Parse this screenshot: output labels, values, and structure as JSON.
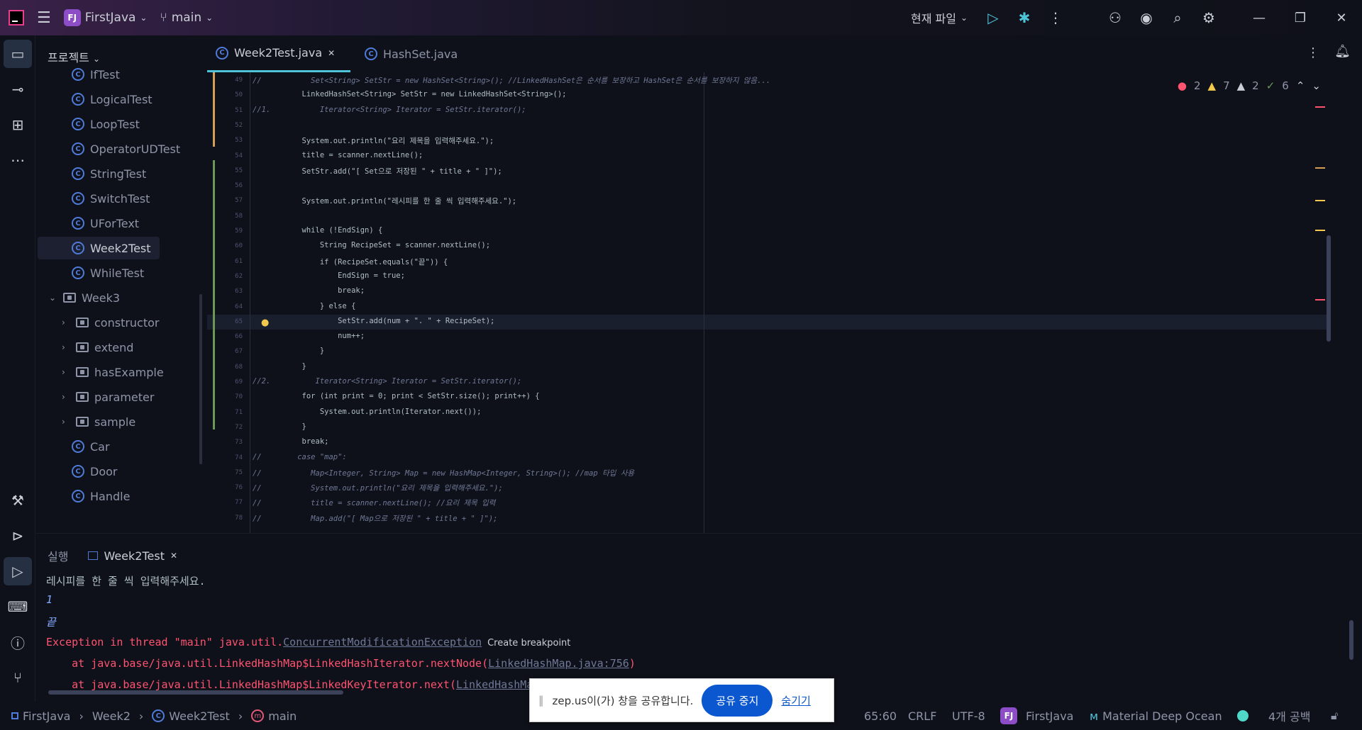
{
  "titlebar": {
    "project_badge": "FJ",
    "project_name": "FirstJava",
    "branch": "main",
    "run_config": "현재 파일",
    "icons": [
      "app-logo-icon",
      "menu-icon",
      "branch-icon",
      "run-icon",
      "debug-icon",
      "more-icon",
      "add-user-icon",
      "record-icon",
      "search-icon",
      "settings-icon",
      "minimize-icon",
      "restore-icon",
      "close-icon"
    ]
  },
  "leftbar": {
    "icons": [
      "project-icon",
      "commit-icon",
      "structure-icon",
      "more-icon",
      "build-icon",
      "services-icon",
      "run-icon",
      "terminal-icon",
      "problems-icon",
      "git-icon"
    ]
  },
  "project_panel": {
    "title": "프로젝트",
    "items": [
      {
        "label": "IfTest",
        "kind": "class"
      },
      {
        "label": "LogicalTest",
        "kind": "class"
      },
      {
        "label": "LoopTest",
        "kind": "class"
      },
      {
        "label": "OperatorUDTest",
        "kind": "class"
      },
      {
        "label": "StringTest",
        "kind": "class"
      },
      {
        "label": "SwitchTest",
        "kind": "class"
      },
      {
        "label": "UForText",
        "kind": "class"
      },
      {
        "label": "Week2Test",
        "kind": "class",
        "selected": true
      },
      {
        "label": "WhileTest",
        "kind": "class"
      },
      {
        "label": "Week3",
        "kind": "folder",
        "open": true
      },
      {
        "label": "constructor",
        "kind": "folder"
      },
      {
        "label": "extend",
        "kind": "folder"
      },
      {
        "label": "hasExample",
        "kind": "folder"
      },
      {
        "label": "parameter",
        "kind": "folder"
      },
      {
        "label": "sample",
        "kind": "folder"
      },
      {
        "label": "Car",
        "kind": "class"
      },
      {
        "label": "Door",
        "kind": "class"
      },
      {
        "label": "Handle",
        "kind": "class"
      }
    ]
  },
  "editor_tabs": [
    {
      "label": "Week2Test.java",
      "active": true
    },
    {
      "label": "HashSet.java",
      "active": false
    }
  ],
  "inspections": {
    "errors": "2",
    "warnings": "7",
    "weak_warnings": "2",
    "ok": "6"
  },
  "code": [
    {
      "n": "49",
      "text": "//           Set<String> SetStr = new HashSet<String>(); //LinkedHashSet은 순서를 보장하고 HashSet은 순서를 보장하지 않음...",
      "cmt": true
    },
    {
      "n": "50",
      "text": "           LinkedHashSet<String> SetStr = new LinkedHashSet<String>();",
      "cmt": false
    },
    {
      "n": "51",
      "text": "//1.           Iterator<String> Iterator = SetStr.iterator();",
      "cmt": true
    },
    {
      "n": "52",
      "text": "",
      "cmt": false
    },
    {
      "n": "53",
      "text": "           System.out.println(\"요리 제목을 입력해주세요.\");",
      "cmt": false
    },
    {
      "n": "54",
      "text": "           title = scanner.nextLine();",
      "cmt": false
    },
    {
      "n": "55",
      "text": "           SetStr.add(\"[ Set으로 저장된 \" + title + \" ]\");",
      "cmt": false
    },
    {
      "n": "56",
      "text": "",
      "cmt": false
    },
    {
      "n": "57",
      "text": "           System.out.println(\"레시피를 한 줄 씩 입력해주세요.\");",
      "cmt": false
    },
    {
      "n": "58",
      "text": "",
      "cmt": false
    },
    {
      "n": "59",
      "text": "           while (!EndSign) {",
      "cmt": false
    },
    {
      "n": "60",
      "text": "               String RecipeSet = scanner.nextLine();",
      "cmt": false
    },
    {
      "n": "61",
      "text": "               if (RecipeSet.equals(\"끝\")) {",
      "cmt": false
    },
    {
      "n": "62",
      "text": "                   EndSign = true;",
      "cmt": false
    },
    {
      "n": "63",
      "text": "                   break;",
      "cmt": false
    },
    {
      "n": "64",
      "text": "               } else {",
      "cmt": false
    },
    {
      "n": "65",
      "text": "                   SetStr.add(num + \". \" + RecipeSet);",
      "cmt": false
    },
    {
      "n": "66",
      "text": "                   num++;",
      "cmt": false
    },
    {
      "n": "67",
      "text": "               }",
      "cmt": false
    },
    {
      "n": "68",
      "text": "           }",
      "cmt": false
    },
    {
      "n": "69",
      "text": "//2.          Iterator<String> Iterator = SetStr.iterator();",
      "cmt": true
    },
    {
      "n": "70",
      "text": "           for (int print = 0; print < SetStr.size(); print++) {",
      "cmt": false
    },
    {
      "n": "71",
      "text": "               System.out.println(Iterator.next());",
      "cmt": false
    },
    {
      "n": "72",
      "text": "           }",
      "cmt": false
    },
    {
      "n": "73",
      "text": "           break;",
      "cmt": false
    },
    {
      "n": "74",
      "text": "//        case \"map\":",
      "cmt": true
    },
    {
      "n": "75",
      "text": "//           Map<Integer, String> Map = new HashMap<Integer, String>(); //map 타입 사용",
      "cmt": true
    },
    {
      "n": "76",
      "text": "//           System.out.println(\"요리 제목을 입력해주세요.\");",
      "cmt": true
    },
    {
      "n": "77",
      "text": "//           title = scanner.nextLine(); //요리 제목 입력",
      "cmt": true
    },
    {
      "n": "78",
      "text": "//           Map.add(\"[ Map으로 저장된 \" + title + \" ]\");",
      "cmt": true
    }
  ],
  "run_panel": {
    "title": "실행",
    "tab": "Week2Test",
    "lines": [
      {
        "text": "레시피를 한 줄 씩 입력해주세요.",
        "style": "normal"
      },
      {
        "text": "1",
        "style": "input"
      },
      {
        "text": "끝",
        "style": "input"
      },
      {
        "text": "Exception in thread \"main\" java.util.",
        "style": "error",
        "link": "ConcurrentModificationException",
        "suffix": "Create breakpoint"
      },
      {
        "text": "    at java.base/java.util.LinkedHashMap$LinkedHashIterator.nextNode(",
        "style": "error",
        "link": "LinkedHashMap.java:756",
        "tail": ")"
      },
      {
        "text": "    at java.base/java.util.LinkedHashMap$LinkedKeyIterator.next(",
        "style": "error",
        "link": "LinkedHashMa",
        "tail": ""
      }
    ]
  },
  "statusbar": {
    "breadcrumb": [
      "FirstJava",
      "Week2",
      "Week2Test",
      "main"
    ],
    "position": "65:60",
    "line_sep": "CRLF",
    "encoding": "UTF-8",
    "project_badge": "FJ",
    "project": "FirstJava",
    "theme": "Material Deep Ocean",
    "indent": "4개 공백"
  },
  "share_bar": {
    "text": "zep.us이(가) 창을 공유합니다.",
    "stop": "공유 중지",
    "hide": "숨기기"
  },
  "colors": {
    "accent": "#4fc3d8",
    "error": "#ff5370",
    "keyword": "#c792ea",
    "string": "#c3e88d",
    "comment": "#6f7896"
  }
}
